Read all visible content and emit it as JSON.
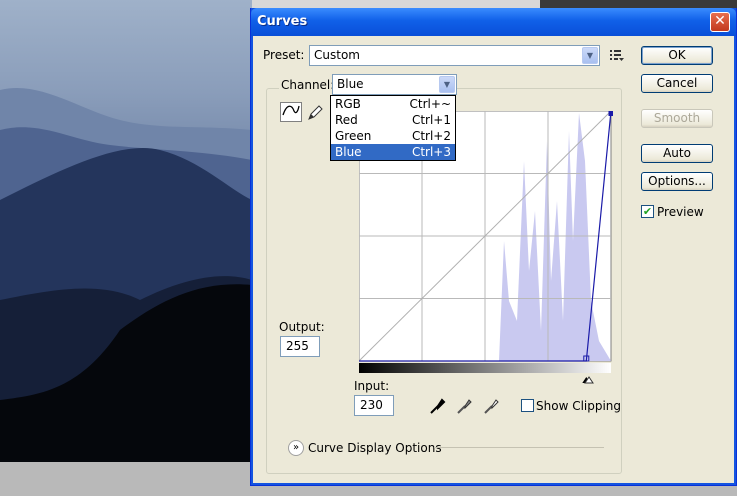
{
  "window": {
    "title": "Curves",
    "close_glyph": "✕"
  },
  "preset": {
    "label": "Preset:",
    "value": "Custom"
  },
  "channel": {
    "label": "Channel:",
    "value": "Blue",
    "options": [
      {
        "name": "RGB",
        "shortcut": "Ctrl+~"
      },
      {
        "name": "Red",
        "shortcut": "Ctrl+1"
      },
      {
        "name": "Green",
        "shortcut": "Ctrl+2"
      },
      {
        "name": "Blue",
        "shortcut": "Ctrl+3"
      }
    ],
    "selected_index": 3
  },
  "buttons": {
    "ok": "OK",
    "cancel": "Cancel",
    "smooth": "Smooth",
    "auto": "Auto",
    "options": "Options..."
  },
  "preview": {
    "label": "Preview",
    "checked": true
  },
  "output": {
    "label": "Output:",
    "value": "255"
  },
  "input": {
    "label": "Input:",
    "value": "230"
  },
  "show_clipping": {
    "label": "Show Clipping",
    "checked": false
  },
  "curve_display": {
    "label": "Curve Display Options"
  },
  "curve": {
    "points": [
      [
        230,
        0
      ],
      [
        255,
        255
      ]
    ],
    "channel_color": "#1a1aa8"
  },
  "colors": {
    "title_blue": "#0a4fd8",
    "selection": "#316ac5",
    "histogram": "#c9c9f0"
  }
}
